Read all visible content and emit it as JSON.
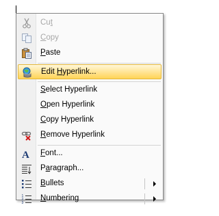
{
  "context_menu": {
    "items": [
      {
        "label": "Cut",
        "mnemonic": "t",
        "icon": "scissors-icon",
        "enabled": false
      },
      {
        "label": "Copy",
        "mnemonic": "C",
        "icon": "copy-icon",
        "enabled": false
      },
      {
        "label": "Paste",
        "mnemonic": "P",
        "icon": "paste-icon",
        "enabled": true
      },
      {
        "label": "Edit Hyperlink...",
        "mnemonic": "H",
        "icon": "edit-hyperlink-icon",
        "enabled": true,
        "highlighted": true
      },
      {
        "label": "Select Hyperlink",
        "mnemonic": "S",
        "enabled": true
      },
      {
        "label": "Open Hyperlink",
        "mnemonic": "O",
        "enabled": true
      },
      {
        "label": "Copy Hyperlink",
        "mnemonic": "C",
        "enabled": true
      },
      {
        "label": "Remove Hyperlink",
        "mnemonic": "R",
        "icon": "remove-hyperlink-icon",
        "enabled": true
      },
      {
        "label": "Font...",
        "mnemonic": "F",
        "icon": "font-icon",
        "enabled": true
      },
      {
        "label": "Paragraph...",
        "mnemonic": "a",
        "icon": "paragraph-icon",
        "enabled": true
      },
      {
        "label": "Bullets",
        "mnemonic": "B",
        "icon": "bullets-icon",
        "enabled": true,
        "submenu": true
      },
      {
        "label": "Numbering",
        "mnemonic": "N",
        "icon": "numbering-icon",
        "enabled": true,
        "submenu": true
      }
    ]
  },
  "colors": {
    "highlight_top": "#fff7d9",
    "highlight_bottom": "#ffd456",
    "highlight_border": "#e3b73b",
    "disabled_text": "#a7a7a7"
  }
}
